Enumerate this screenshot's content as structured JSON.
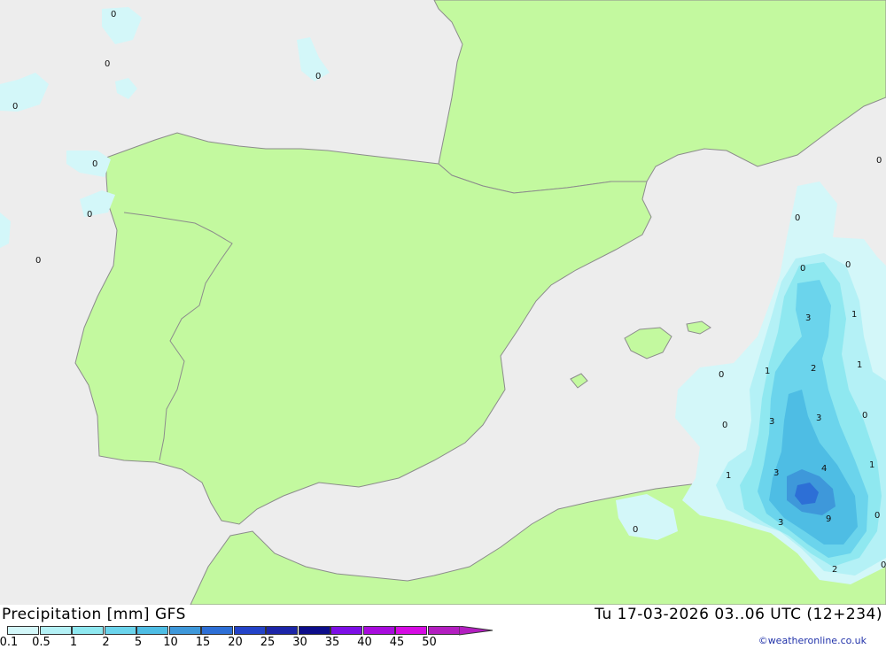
{
  "title": {
    "product": "Precipitation [mm]",
    "model": "GFS",
    "valid_time": "Tu 17-03-2026 03..06 UTC (12+234)"
  },
  "copyright": "©weatheronline.co.uk",
  "legend": {
    "labels": [
      "0.1",
      "0.5",
      "1",
      "2",
      "5",
      "10",
      "15",
      "20",
      "25",
      "30",
      "35",
      "40",
      "45",
      "50"
    ],
    "colors": [
      "#d3f7f9",
      "#b4f1f6",
      "#8fe8f0",
      "#6bd4ec",
      "#4ebde4",
      "#3e98da",
      "#2d6fd6",
      "#2343c8",
      "#1c25a8",
      "#0d0d8a",
      "#7d0fe6",
      "#a80cdd",
      "#d60ce3",
      "#b31ec0"
    ]
  },
  "map": {
    "sea_color": "#ededed",
    "land_color": "#c3f99f",
    "border_color": "#8c8c8c",
    "values": [
      {
        "label": "0"
      },
      {
        "label": "0"
      },
      {
        "label": "0"
      },
      {
        "label": "0"
      },
      {
        "label": "0"
      },
      {
        "label": "0"
      },
      {
        "label": "0"
      },
      {
        "label": "0"
      },
      {
        "label": "0"
      },
      {
        "label": "0"
      },
      {
        "label": "0"
      },
      {
        "label": "3"
      },
      {
        "label": "1"
      },
      {
        "label": "0"
      },
      {
        "label": "1"
      },
      {
        "label": "2"
      },
      {
        "label": "1"
      },
      {
        "label": "0"
      },
      {
        "label": "3"
      },
      {
        "label": "3"
      },
      {
        "label": "0"
      },
      {
        "label": "4"
      },
      {
        "label": "1"
      },
      {
        "label": "1"
      },
      {
        "label": "3"
      },
      {
        "label": "9"
      },
      {
        "label": "3"
      },
      {
        "label": "0"
      },
      {
        "label": "0"
      },
      {
        "label": "2"
      },
      {
        "label": "0"
      },
      {
        "label": "0"
      }
    ]
  }
}
